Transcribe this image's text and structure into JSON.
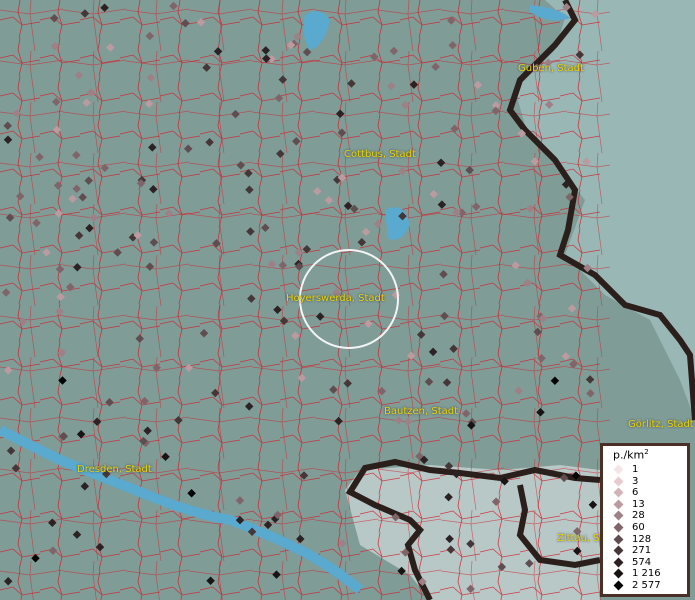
{
  "cities": {
    "guben": "Guben, Stadt",
    "cottbus": "Cottbus, Stadt",
    "hoyerswerda": "Hoyerswerda, Stadt",
    "bautzen": "Bautzen, Stadt",
    "goerlitz": "Görlitz, Stadt",
    "dresden": "Dresden, Stadt",
    "zittau": "Zittau, St"
  },
  "legend": {
    "title_base": "p./km",
    "title_sup": "2",
    "items": [
      {
        "label": "1",
        "color": "#f3e4e5"
      },
      {
        "label": "3",
        "color": "#e6ccd0"
      },
      {
        "label": "6",
        "color": "#d3b2b8"
      },
      {
        "label": "13",
        "color": "#bb9aa0"
      },
      {
        "label": "28",
        "color": "#9e8087"
      },
      {
        "label": "60",
        "color": "#7f6569"
      },
      {
        "label": "128",
        "color": "#5f4d50"
      },
      {
        "label": "271",
        "color": "#453638"
      },
      {
        "label": "574",
        "color": "#2c2224"
      },
      {
        "label": "1 216",
        "color": "#191314"
      },
      {
        "label": "2 577",
        "color": "#050404"
      }
    ]
  },
  "colors": {
    "land": "#809e98",
    "water": "#5ea8c8",
    "border": "#c0262d",
    "national_border": "#2a1f1c",
    "label": "#e8d400"
  }
}
